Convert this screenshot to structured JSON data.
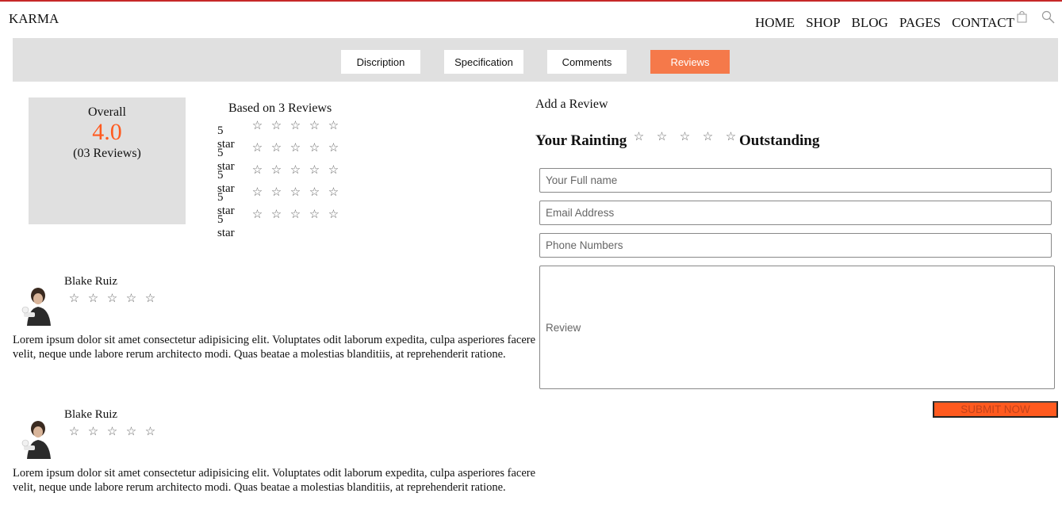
{
  "header": {
    "brand": "KARMA",
    "nav": [
      "HOME",
      "SHOP",
      "BLOG",
      "PAGES",
      "CONTACT"
    ]
  },
  "tabs": [
    "Discription",
    "Specification",
    "Comments",
    "Reviews"
  ],
  "active_tab": "Reviews",
  "overall": {
    "label": "Overall",
    "score": "4.0",
    "count": "(03 Reviews)"
  },
  "breakdown": {
    "title": "Based on 3 Reviews",
    "rows": [
      "5 star",
      "5 star",
      "5 star",
      "5 star",
      "5 star"
    ]
  },
  "reviews": [
    {
      "name": "Blake Ruiz",
      "text": "Lorem ipsum dolor sit amet consectetur adipisicing elit. Voluptates odit laborum expedita, culpa asperiores facere velit, neque unde labore rerum architecto modi. Quas beatae a molestias blanditiis, at reprehenderit ratione."
    },
    {
      "name": "Blake Ruiz",
      "text": "Lorem ipsum dolor sit amet consectetur adipisicing elit. Voluptates odit laborum expedita, culpa asperiores facere velit, neque unde labore rerum architecto modi. Quas beatae a molestias blanditiis, at reprehenderit ratione."
    }
  ],
  "form": {
    "title": "Add a Review",
    "rating_label": "Your Rainting",
    "rating_word": "Outstanding",
    "name_placeholder": "Your Full name",
    "email_placeholder": "Email Address",
    "phone_placeholder": "Phone Numbers",
    "review_placeholder": "Review",
    "submit_label": "SUBMIT NOW"
  },
  "colors": {
    "accent": "#ff5a1f",
    "tab_active": "#f5794a",
    "panel_gray": "#e0e0e0",
    "top_border": "#c62828"
  },
  "icons": [
    "cart-icon",
    "search-icon",
    "star-outline-icon"
  ]
}
